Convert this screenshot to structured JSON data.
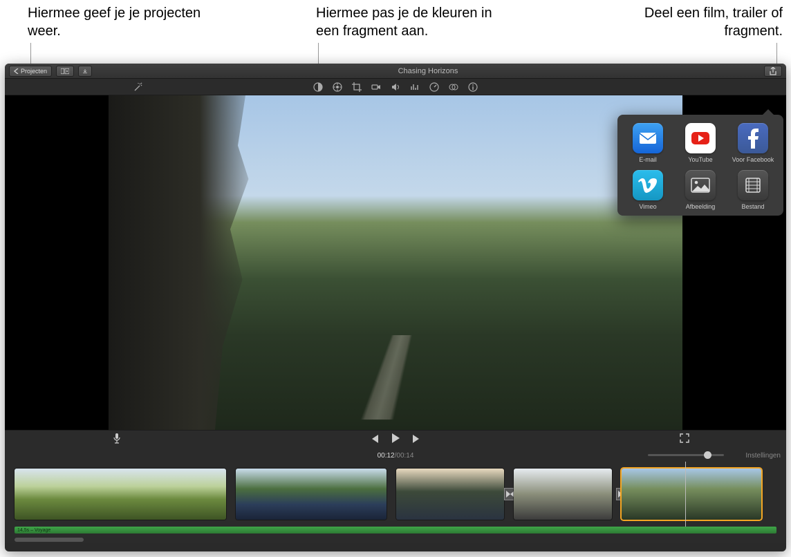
{
  "callouts": {
    "projects": "Hiermee geef je je projecten weer.",
    "color": "Hiermee pas je de kleuren in een fragment aan.",
    "share": "Deel een film, trailer of fragment."
  },
  "titlebar": {
    "projects_button": "Projecten",
    "title": "Chasing Horizons"
  },
  "playback": {
    "elapsed": "00:12",
    "sep": " / ",
    "total": "00:14"
  },
  "settings_label": "Instellingen",
  "audio": {
    "track_label": "14,5s – Voyage"
  },
  "share": {
    "items": [
      {
        "key": "email",
        "label": "E-mail"
      },
      {
        "key": "youtube",
        "label": "YouTube"
      },
      {
        "key": "facebook",
        "label": "Voor Facebook"
      },
      {
        "key": "vimeo",
        "label": "Vimeo"
      },
      {
        "key": "image",
        "label": "Afbeelding"
      },
      {
        "key": "file",
        "label": "Bestand"
      }
    ]
  }
}
